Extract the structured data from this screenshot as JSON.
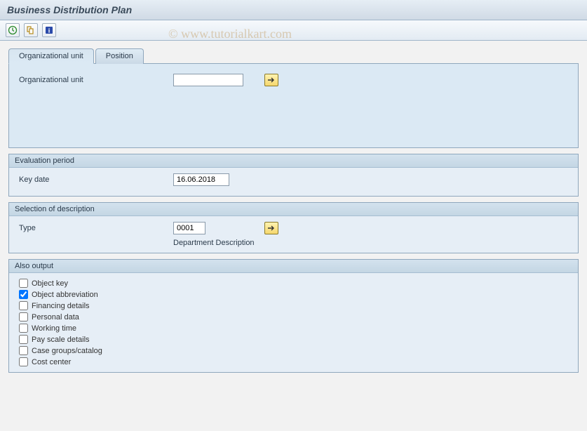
{
  "header": {
    "title": "Business Distribution Plan"
  },
  "watermark": "© www.tutorialkart.com",
  "toolbar": {
    "execute_icon": "execute",
    "get_variant_icon": "get-variant",
    "info_icon": "info"
  },
  "tabs": [
    {
      "label": "Organizational unit",
      "active": true
    },
    {
      "label": "Position",
      "active": false
    }
  ],
  "orgunit": {
    "label": "Organizational unit",
    "value": "",
    "placeholder": ""
  },
  "evaluation_period": {
    "title": "Evaluation period",
    "key_date_label": "Key date",
    "key_date_value": "16.06.2018"
  },
  "selection_description": {
    "title": "Selection of description",
    "type_label": "Type",
    "type_value": "0001",
    "type_description": "Department Description"
  },
  "also_output": {
    "title": "Also output",
    "options": [
      {
        "label": "Object key",
        "checked": false
      },
      {
        "label": "Object abbreviation",
        "checked": true
      },
      {
        "label": "Financing details",
        "checked": false
      },
      {
        "label": "Personal data",
        "checked": false
      },
      {
        "label": "Working time",
        "checked": false
      },
      {
        "label": "Pay scale details",
        "checked": false
      },
      {
        "label": "Case groups/catalog",
        "checked": false
      },
      {
        "label": "Cost center",
        "checked": false
      }
    ]
  }
}
